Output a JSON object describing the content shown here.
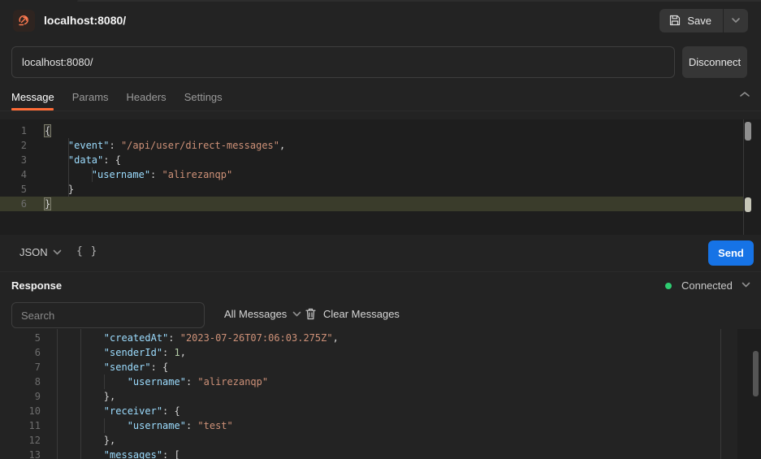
{
  "header": {
    "title": "localhost:8080/",
    "save_label": "Save"
  },
  "connection": {
    "url": "localhost:8080/",
    "disconnect_label": "Disconnect",
    "status_label": "Connected"
  },
  "tabs": [
    {
      "label": "Message",
      "active": true
    },
    {
      "label": "Params",
      "active": false
    },
    {
      "label": "Headers",
      "active": false
    },
    {
      "label": "Settings",
      "active": false
    }
  ],
  "compose": {
    "format_label": "JSON",
    "beautify_icon": "{ }",
    "send_label": "Send"
  },
  "response": {
    "section_label": "Response",
    "search_placeholder": "Search",
    "filter_label": "All Messages",
    "clear_label": "Clear Messages"
  },
  "colors": {
    "accent_orange": "#ff6c37",
    "send_blue": "#1673e6",
    "status_green": "#2ecc71",
    "syntax_key": "#9cdcfe",
    "syntax_string": "#ce9178",
    "syntax_number": "#b5cea8",
    "syntax_punctuation": "#d4d4d4"
  },
  "message_editor": {
    "active_line": 6,
    "lines": [
      {
        "num": 1,
        "tokens": [
          [
            "b",
            "{"
          ]
        ]
      },
      {
        "num": 2,
        "tokens": [
          [
            "p",
            "    "
          ],
          [
            "k",
            "\"event\""
          ],
          [
            "p",
            ": "
          ],
          [
            "s",
            "\"/api/user/direct-messages\""
          ],
          [
            "p",
            ","
          ]
        ]
      },
      {
        "num": 3,
        "tokens": [
          [
            "p",
            "    "
          ],
          [
            "k",
            "\"data\""
          ],
          [
            "p",
            ": {"
          ]
        ]
      },
      {
        "num": 4,
        "tokens": [
          [
            "p",
            "        "
          ],
          [
            "k",
            "\"username\""
          ],
          [
            "p",
            ": "
          ],
          [
            "s",
            "\"alirezanqp\""
          ]
        ]
      },
      {
        "num": 5,
        "tokens": [
          [
            "p",
            "    }"
          ]
        ]
      },
      {
        "num": 6,
        "tokens": [
          [
            "b",
            "}"
          ]
        ]
      }
    ]
  },
  "response_editor": {
    "active_line": 0,
    "lines": [
      {
        "num": 5,
        "tokens": [
          [
            "p",
            "        "
          ],
          [
            "k",
            "\"createdAt\""
          ],
          [
            "p",
            ": "
          ],
          [
            "s",
            "\"2023-07-26T07:06:03.275Z\""
          ],
          [
            "p",
            ","
          ]
        ]
      },
      {
        "num": 6,
        "tokens": [
          [
            "p",
            "        "
          ],
          [
            "k",
            "\"senderId\""
          ],
          [
            "p",
            ": "
          ],
          [
            "n",
            "1"
          ],
          [
            "p",
            ","
          ]
        ]
      },
      {
        "num": 7,
        "tokens": [
          [
            "p",
            "        "
          ],
          [
            "k",
            "\"sender\""
          ],
          [
            "p",
            ": {"
          ]
        ]
      },
      {
        "num": 8,
        "tokens": [
          [
            "p",
            "            "
          ],
          [
            "k",
            "\"username\""
          ],
          [
            "p",
            ": "
          ],
          [
            "s",
            "\"alirezanqp\""
          ]
        ]
      },
      {
        "num": 9,
        "tokens": [
          [
            "p",
            "        },"
          ]
        ]
      },
      {
        "num": 10,
        "tokens": [
          [
            "p",
            "        "
          ],
          [
            "k",
            "\"receiver\""
          ],
          [
            "p",
            ": {"
          ]
        ]
      },
      {
        "num": 11,
        "tokens": [
          [
            "p",
            "            "
          ],
          [
            "k",
            "\"username\""
          ],
          [
            "p",
            ": "
          ],
          [
            "s",
            "\"test\""
          ]
        ]
      },
      {
        "num": 12,
        "tokens": [
          [
            "p",
            "        },"
          ]
        ]
      },
      {
        "num": 13,
        "tokens": [
          [
            "p",
            "        "
          ],
          [
            "k",
            "\"messages\""
          ],
          [
            "p",
            ": ["
          ]
        ]
      }
    ]
  }
}
